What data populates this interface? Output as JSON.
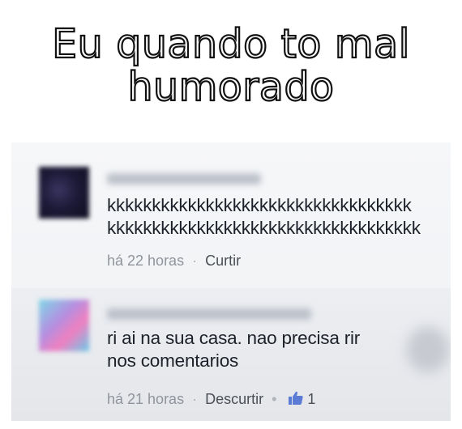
{
  "meme": {
    "title_line_1": "Eu quando to mal",
    "title_line_2": "humorado"
  },
  "comments": [
    {
      "avatar_icon": "blurred-user-avatar",
      "author": "",
      "text": "kkkkkkkkkkkkkkkkkkkkkkkkkkkkkkkkkk\nkkkkkkkkkkkkkkkkkkkkkkkkkkkkkkkkkkk",
      "time": "há 22 horas",
      "separator": "·",
      "action": "Curtir"
    },
    {
      "avatar_icon": "blurred-user-avatar",
      "author": "",
      "text": "ri ai na sua casa. nao precisa rir\nnos comentarios",
      "time": "há 21 horas",
      "separator": "·",
      "action": "Descurtir",
      "separator_2": "•",
      "like_icon": "thumbs-up-icon",
      "like_count": "1"
    }
  ],
  "colors": {
    "like_blue": "#5b7bd5",
    "meta_gray": "#90949c",
    "text_dark": "#1d2129"
  }
}
